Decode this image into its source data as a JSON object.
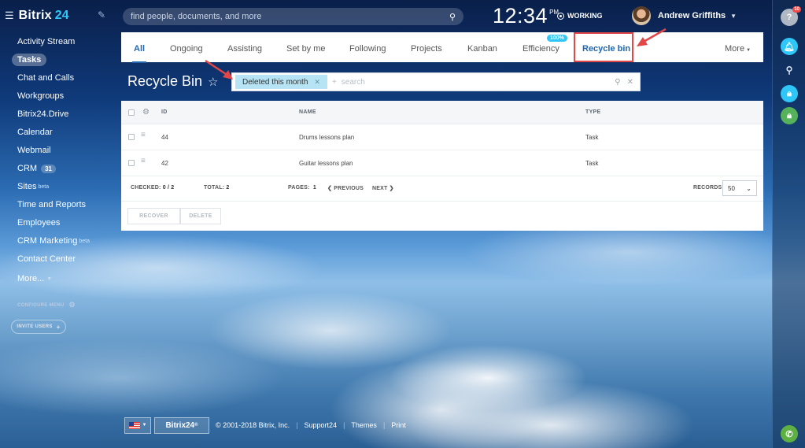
{
  "topbar": {
    "brand": "Bitrix",
    "brand_num": "24",
    "search_placeholder": "find people, documents, and more",
    "time": "12:34",
    "ampm": "PM",
    "working": "WORKING",
    "user_name": "Andrew Griffiths"
  },
  "sidebar": {
    "items": [
      {
        "label": "Activity Stream"
      },
      {
        "label": "Tasks"
      },
      {
        "label": "Chat and Calls"
      },
      {
        "label": "Workgroups"
      },
      {
        "label": "Bitrix24.Drive"
      },
      {
        "label": "Calendar"
      },
      {
        "label": "Webmail"
      },
      {
        "label": "CRM",
        "badge": "31"
      },
      {
        "label": "Sites",
        "sup": "beta"
      },
      {
        "label": "Time and Reports"
      },
      {
        "label": "Employees"
      },
      {
        "label": "CRM Marketing",
        "sup": "beta"
      },
      {
        "label": "Contact Center"
      },
      {
        "label": "More..."
      }
    ],
    "configure_menu": "CONFIGURE MENU",
    "invite_users": "INVITE USERS"
  },
  "right_rail": {
    "help_label": "?",
    "help_count": "10"
  },
  "tabs": {
    "items": [
      {
        "label": "All"
      },
      {
        "label": "Ongoing"
      },
      {
        "label": "Assisting"
      },
      {
        "label": "Set by me"
      },
      {
        "label": "Following"
      },
      {
        "label": "Projects"
      },
      {
        "label": "Kanban"
      },
      {
        "label": "Efficiency",
        "badge": "100%"
      },
      {
        "label": "Recycle bin"
      }
    ],
    "more": "More"
  },
  "page": {
    "title": "Recycle Bin",
    "filter_chip": "Deleted this month",
    "filter_placeholder": "search",
    "filter_plus": "+"
  },
  "grid": {
    "headers": {
      "id": "ID",
      "name": "NAME",
      "type": "TYPE"
    },
    "rows": [
      {
        "id": "44",
        "name": "Drums lessons plan",
        "type": "Task"
      },
      {
        "id": "42",
        "name": "Guitar lessons plan",
        "type": "Task"
      }
    ],
    "footer": {
      "checked_label": "CHECKED:",
      "checked_value": "0 / 2",
      "total_label": "TOTAL:",
      "total_value": "2",
      "pages_label": "PAGES:",
      "pages_value": "1",
      "previous": "PREVIOUS",
      "next": "NEXT",
      "records_label": "RECORDS:",
      "records_value": "50"
    },
    "buttons": {
      "recover": "RECOVER",
      "delete": "DELETE"
    }
  },
  "footer": {
    "brand": "Bitrix24",
    "copyright": "© 2001-2018 Bitrix, Inc.",
    "support": "Support24",
    "themes": "Themes",
    "print": "Print"
  },
  "colors": {
    "accent": "#2067b0",
    "highlight": "#e24646",
    "chip": "#b6e4f4",
    "brand_num": "#2fc7f7"
  }
}
